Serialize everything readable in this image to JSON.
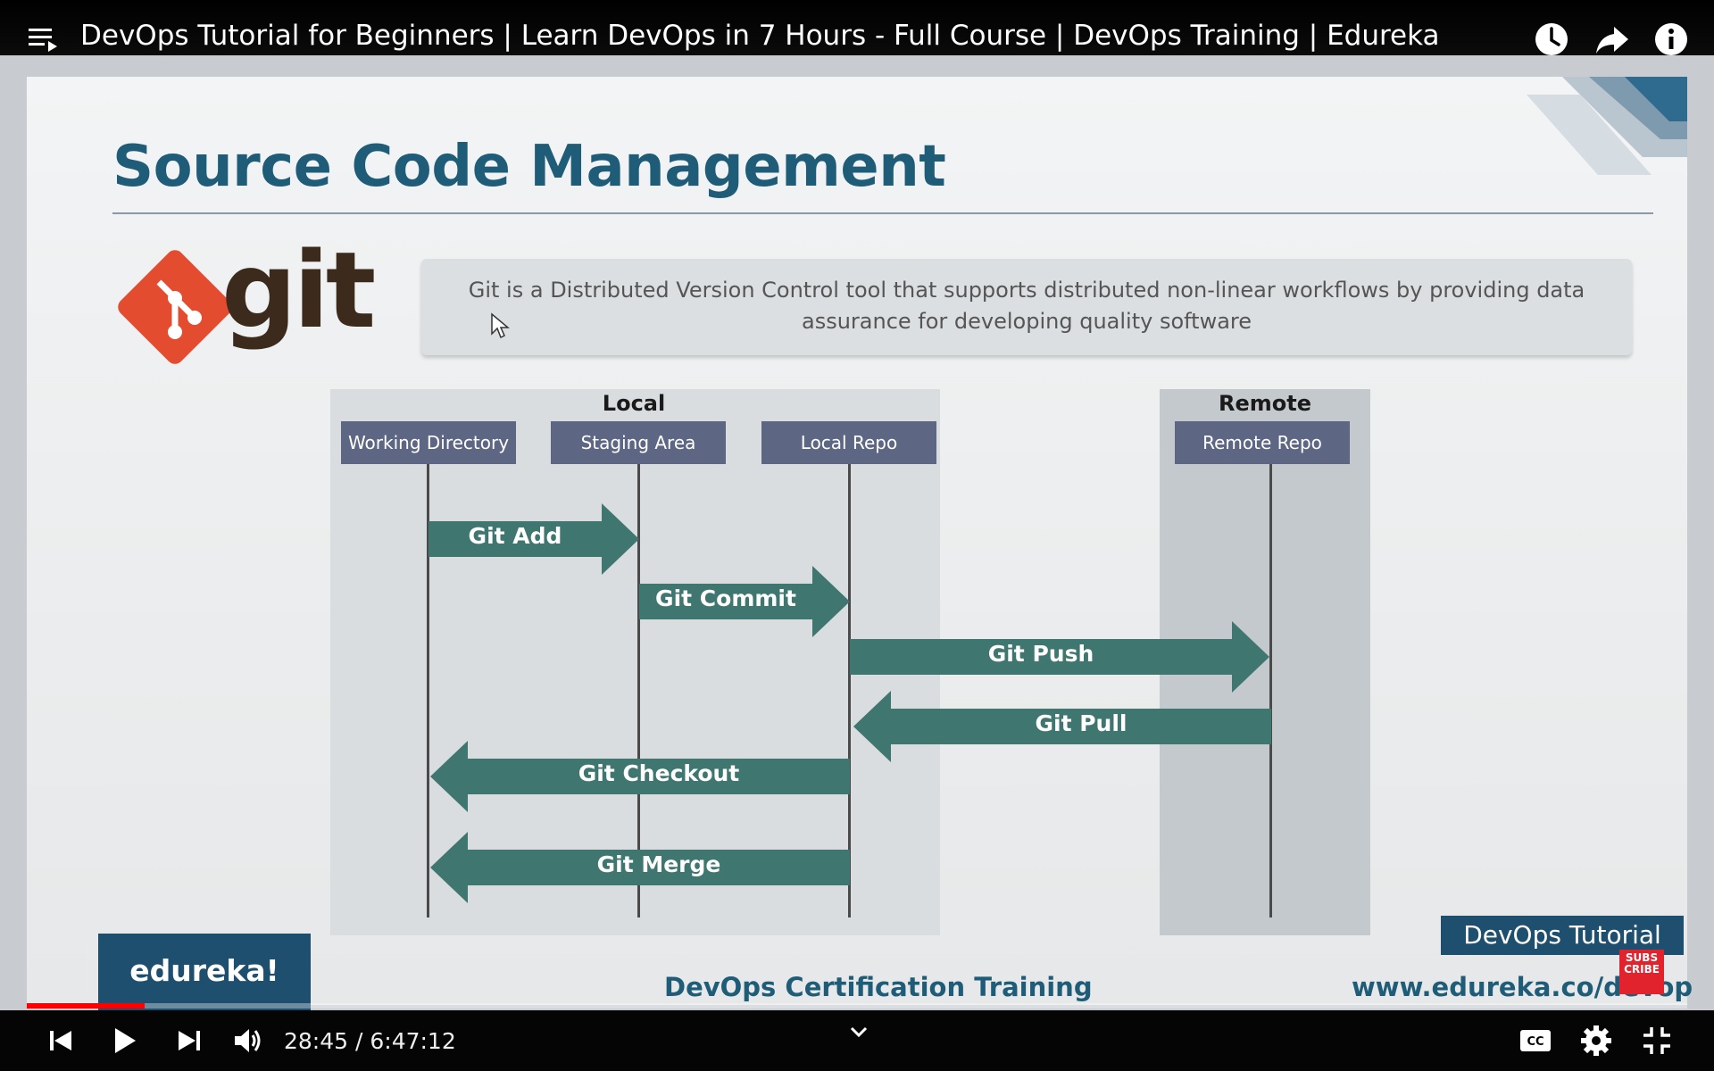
{
  "player": {
    "video_title": "DevOps Tutorial for Beginners | Learn DevOps in 7 Hours - Full Course | DevOps Training | Edureka",
    "current_time": "28:45",
    "duration": "6:47:12",
    "time_display": "28:45 / 6:47:12",
    "progress_fraction": 0.071,
    "icons": {
      "top_left": "playlist-icon",
      "top_right": [
        "watch-later-icon",
        "share-icon",
        "info-icon"
      ],
      "controls_left": [
        "previous-icon",
        "play-icon",
        "next-icon",
        "volume-icon"
      ],
      "controls_center": "chevron-down-icon",
      "controls_right": [
        "captions-icon",
        "settings-icon",
        "exit-fullscreen-icon"
      ]
    },
    "colors": {
      "progress": "#ff0000",
      "background": "#000000"
    }
  },
  "slide": {
    "title": "Source Code Management",
    "logo_word": "git",
    "description": "Git is a Distributed Version Control tool that supports distributed non-linear workflows by providing data assurance for developing quality software",
    "description_line1": "Git is a Distributed Version Control tool that supports distributed non-linear workflows by providing data",
    "description_line2": "assurance for developing quality software",
    "diagram": {
      "local_label": "Local",
      "remote_label": "Remote",
      "lanes": [
        "Working Directory",
        "Staging Area",
        "Local Repo",
        "Remote Repo"
      ],
      "actions": [
        {
          "label": "Git Add",
          "from": "Working Directory",
          "to": "Staging Area"
        },
        {
          "label": "Git Commit",
          "from": "Staging Area",
          "to": "Local Repo"
        },
        {
          "label": "Git Push",
          "from": "Local Repo",
          "to": "Remote Repo"
        },
        {
          "label": "Git Pull",
          "from": "Remote Repo",
          "to": "Local Repo"
        },
        {
          "label": "Git Checkout",
          "from": "Local Repo",
          "to": "Working Directory"
        },
        {
          "label": "Git Merge",
          "from": "Local Repo",
          "to": "Working Directory"
        }
      ],
      "arrow_color": "#3f7670"
    },
    "footer": {
      "brand": "edureka!",
      "center": "DevOps Certification Training",
      "url": "www.edureka.co/devop",
      "tag": "DevOps Tutorial",
      "subscribe": [
        "SUBS",
        "CRIBE"
      ]
    },
    "colors": {
      "title": "#1f5c78",
      "git_logo": "#e44c30",
      "lane_box": "#5d6682"
    }
  }
}
